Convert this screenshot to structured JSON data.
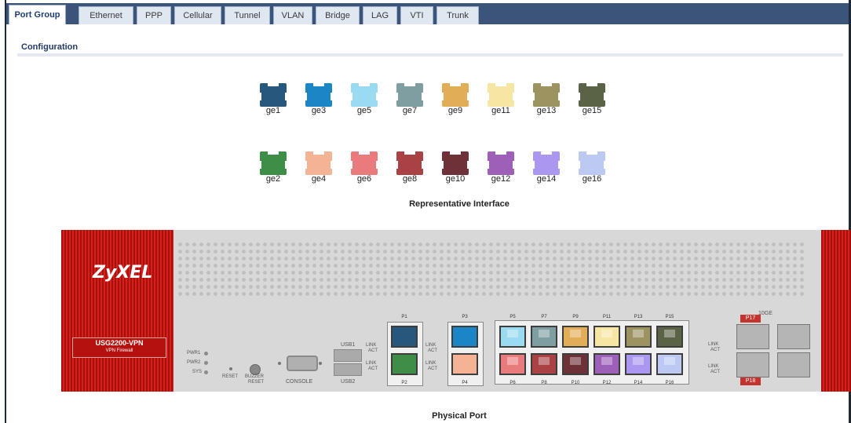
{
  "tabs": [
    "Port Group",
    "Ethernet",
    "PPP",
    "Cellular",
    "Tunnel",
    "VLAN",
    "Bridge",
    "LAG",
    "VTI",
    "Trunk"
  ],
  "active_tab": "Port Group",
  "section_title": "Configuration",
  "representative_label": "Representative Interface",
  "physical_label": "Physical Port",
  "rep_top": [
    {
      "name": "ge1",
      "color": "#28577d"
    },
    {
      "name": "ge3",
      "color": "#1a86c6"
    },
    {
      "name": "ge5",
      "color": "#9bdbf2"
    },
    {
      "name": "ge7",
      "color": "#7f9ea2"
    },
    {
      "name": "ge9",
      "color": "#e2ad57"
    },
    {
      "name": "ge11",
      "color": "#f6e6a4"
    },
    {
      "name": "ge13",
      "color": "#9c9361"
    },
    {
      "name": "ge15",
      "color": "#5a6345"
    }
  ],
  "rep_bottom": [
    {
      "name": "ge2",
      "color": "#3f8e47"
    },
    {
      "name": "ge4",
      "color": "#f3b394"
    },
    {
      "name": "ge6",
      "color": "#ea7b7c"
    },
    {
      "name": "ge8",
      "color": "#aa4145"
    },
    {
      "name": "ge10",
      "color": "#6f3138"
    },
    {
      "name": "ge12",
      "color": "#9d5fb8"
    },
    {
      "name": "ge14",
      "color": "#ab97ef"
    },
    {
      "name": "ge16",
      "color": "#bbc9f3"
    }
  ],
  "device": {
    "brand": "ZyXEL",
    "model": "USG2200-VPN",
    "model_sub": "VPN Firewall",
    "leds": [
      "PWR1",
      "PWR2",
      "SYS"
    ],
    "reset": "RESET",
    "buzzer": "BUZZER",
    "buzzer2": "RESET",
    "console": "CONSOLE",
    "usb1": "USB1",
    "usb2": "USB2",
    "link": "LINK",
    "act": "ACT",
    "tengig": "10GE",
    "ports_top": [
      {
        "label": "P1",
        "color": "#28577d"
      },
      {
        "label": "P3",
        "color": "#1a86c6"
      },
      {
        "label": "P5",
        "color": "#9bdbf2"
      },
      {
        "label": "P7",
        "color": "#7f9ea2"
      },
      {
        "label": "P9",
        "color": "#e2ad57"
      },
      {
        "label": "P11",
        "color": "#f6e6a4"
      },
      {
        "label": "P13",
        "color": "#9c9361"
      },
      {
        "label": "P15",
        "color": "#5a6345"
      }
    ],
    "ports_bottom": [
      {
        "label": "P2",
        "color": "#3f8e47"
      },
      {
        "label": "P4",
        "color": "#f3b394"
      },
      {
        "label": "P6",
        "color": "#ea7b7c"
      },
      {
        "label": "P8",
        "color": "#aa4145"
      },
      {
        "label": "P10",
        "color": "#6f3138"
      },
      {
        "label": "P12",
        "color": "#9d5fb8"
      },
      {
        "label": "P14",
        "color": "#ab97ef"
      },
      {
        "label": "P16",
        "color": "#bbc9f3"
      }
    ],
    "sfp_top": "P17",
    "sfp_bottom": "P18"
  }
}
